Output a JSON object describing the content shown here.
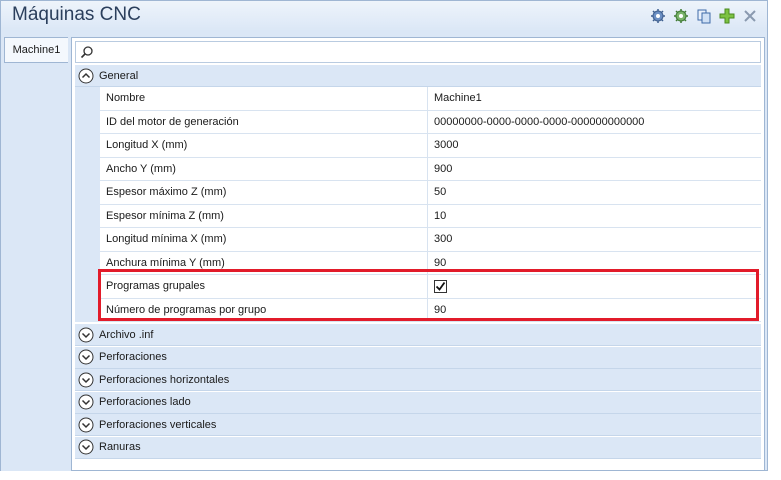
{
  "window": {
    "title": "Máquinas CNC"
  },
  "toolbar": {
    "buttons": [
      {
        "icon": "settings-gear-icon"
      },
      {
        "icon": "settings-gear-green-icon"
      },
      {
        "icon": "copy-icon"
      },
      {
        "icon": "add-icon"
      },
      {
        "icon": "close-icon"
      }
    ]
  },
  "tabs": [
    {
      "label": "Machine1"
    }
  ],
  "search": {
    "placeholder": "",
    "value": ""
  },
  "categories": {
    "general": {
      "label": "General",
      "expanded": true,
      "properties": [
        {
          "name": "Nombre",
          "value": "Machine1"
        },
        {
          "name": "ID del motor de generación",
          "value": "00000000-0000-0000-0000-000000000000"
        },
        {
          "name": "Longitud X (mm)",
          "value": "3000"
        },
        {
          "name": "Ancho Y (mm)",
          "value": "900"
        },
        {
          "name": "Espesor máximo Z (mm)",
          "value": "50"
        },
        {
          "name": "Espesor mínima Z (mm)",
          "value": "10"
        },
        {
          "name": "Longitud mínima X (mm)",
          "value": "300"
        },
        {
          "name": "Anchura mínima Y (mm)",
          "value": "90"
        },
        {
          "name": "Programas grupales",
          "value": "",
          "checked": true
        },
        {
          "name": "Número de programas por grupo",
          "value": "90"
        }
      ]
    },
    "collapsed": [
      {
        "label": "Archivo .inf"
      },
      {
        "label": "Perforaciones"
      },
      {
        "label": "Perforaciones horizontales"
      },
      {
        "label": "Perforaciones lado"
      },
      {
        "label": "Perforaciones verticales"
      },
      {
        "label": "Ranuras"
      }
    ]
  },
  "colors": {
    "accent": "#dbe7f6",
    "highlight": "#e21b2a"
  }
}
